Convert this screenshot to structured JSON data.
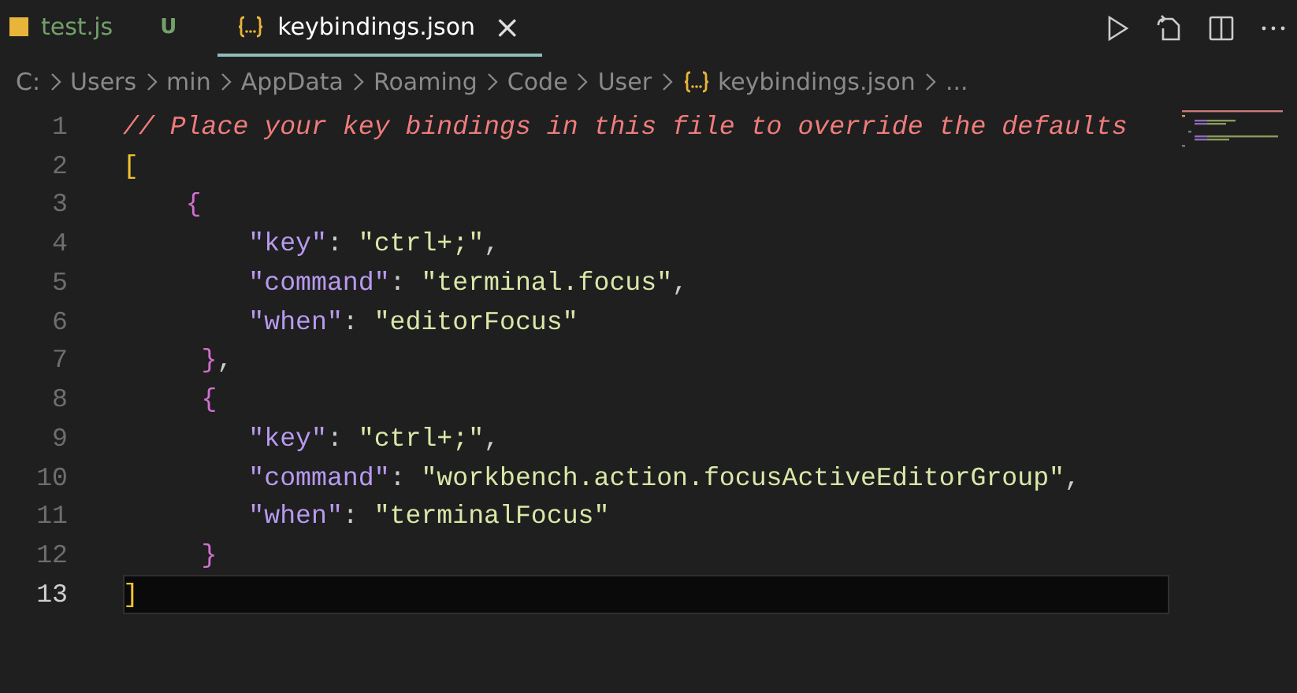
{
  "tabs": [
    {
      "label": "test.js",
      "status": "U",
      "selected": false
    },
    {
      "label": "keybindings.json",
      "selected": true,
      "close": "×"
    }
  ],
  "breadcrumb": [
    {
      "kind": "folder",
      "label": "C:"
    },
    {
      "kind": "folder",
      "label": "Users"
    },
    {
      "kind": "folder",
      "label": "min"
    },
    {
      "kind": "folder",
      "label": "AppData"
    },
    {
      "kind": "folder",
      "label": "Roaming"
    },
    {
      "kind": "folder",
      "label": "Code"
    },
    {
      "kind": "folder",
      "label": "User"
    },
    {
      "kind": "json",
      "label": "keybindings.json"
    },
    {
      "kind": "folder",
      "label": "..."
    }
  ],
  "lines": [
    {
      "number": "1",
      "current": false,
      "tokens": [
        {
          "kind": "comment",
          "text": "// Place your key bindings in this file to override the defaults"
        }
      ]
    },
    {
      "number": "2",
      "current": false,
      "tokens": [
        {
          "kind": "bracket",
          "text": "["
        }
      ]
    },
    {
      "number": "3",
      "current": false,
      "tokens": [
        {
          "kind": "brace",
          "text": "    {"
        }
      ]
    },
    {
      "number": "4",
      "current": false,
      "tokens": [
        {
          "kind": "key",
          "text": "        \"key\""
        },
        {
          "kind": "punct",
          "text": ": "
        },
        {
          "kind": "string",
          "text": "\"ctrl+;\""
        },
        {
          "kind": "punct",
          "text": ","
        }
      ]
    },
    {
      "number": "5",
      "current": false,
      "tokens": [
        {
          "kind": "key",
          "text": "        \"command\""
        },
        {
          "kind": "punct",
          "text": ": "
        },
        {
          "kind": "string",
          "text": "\"terminal.focus\""
        },
        {
          "kind": "punct",
          "text": ","
        }
      ]
    },
    {
      "number": "6",
      "current": false,
      "tokens": [
        {
          "kind": "key",
          "text": "        \"when\""
        },
        {
          "kind": "punct",
          "text": ": "
        },
        {
          "kind": "string",
          "text": "\"editorFocus\""
        }
      ]
    },
    {
      "number": "7",
      "current": false,
      "tokens": [
        {
          "kind": "brace",
          "text": "     }"
        },
        {
          "kind": "punct",
          "text": ","
        }
      ]
    },
    {
      "number": "8",
      "current": false,
      "tokens": [
        {
          "kind": "brace",
          "text": "     {"
        }
      ]
    },
    {
      "number": "9",
      "current": false,
      "tokens": [
        {
          "kind": "key",
          "text": "        \"key\""
        },
        {
          "kind": "punct",
          "text": ": "
        },
        {
          "kind": "string",
          "text": "\"ctrl+;\""
        },
        {
          "kind": "punct",
          "text": ","
        }
      ]
    },
    {
      "number": "10",
      "current": false,
      "tokens": [
        {
          "kind": "key",
          "text": "        \"command\""
        },
        {
          "kind": "punct",
          "text": ": "
        },
        {
          "kind": "string",
          "text": "\"workbench.action.focusActiveEditorGroup\""
        },
        {
          "kind": "punct",
          "text": ","
        }
      ]
    },
    {
      "number": "11",
      "current": false,
      "tokens": [
        {
          "kind": "key",
          "text": "        \"when\""
        },
        {
          "kind": "punct",
          "text": ": "
        },
        {
          "kind": "string",
          "text": "\"terminalFocus\""
        }
      ]
    },
    {
      "number": "12",
      "current": false,
      "tokens": [
        {
          "kind": "brace",
          "text": "     }"
        }
      ]
    },
    {
      "number": "13",
      "current": true,
      "tokens": [
        {
          "kind": "bracket",
          "text": "]"
        }
      ]
    }
  ]
}
